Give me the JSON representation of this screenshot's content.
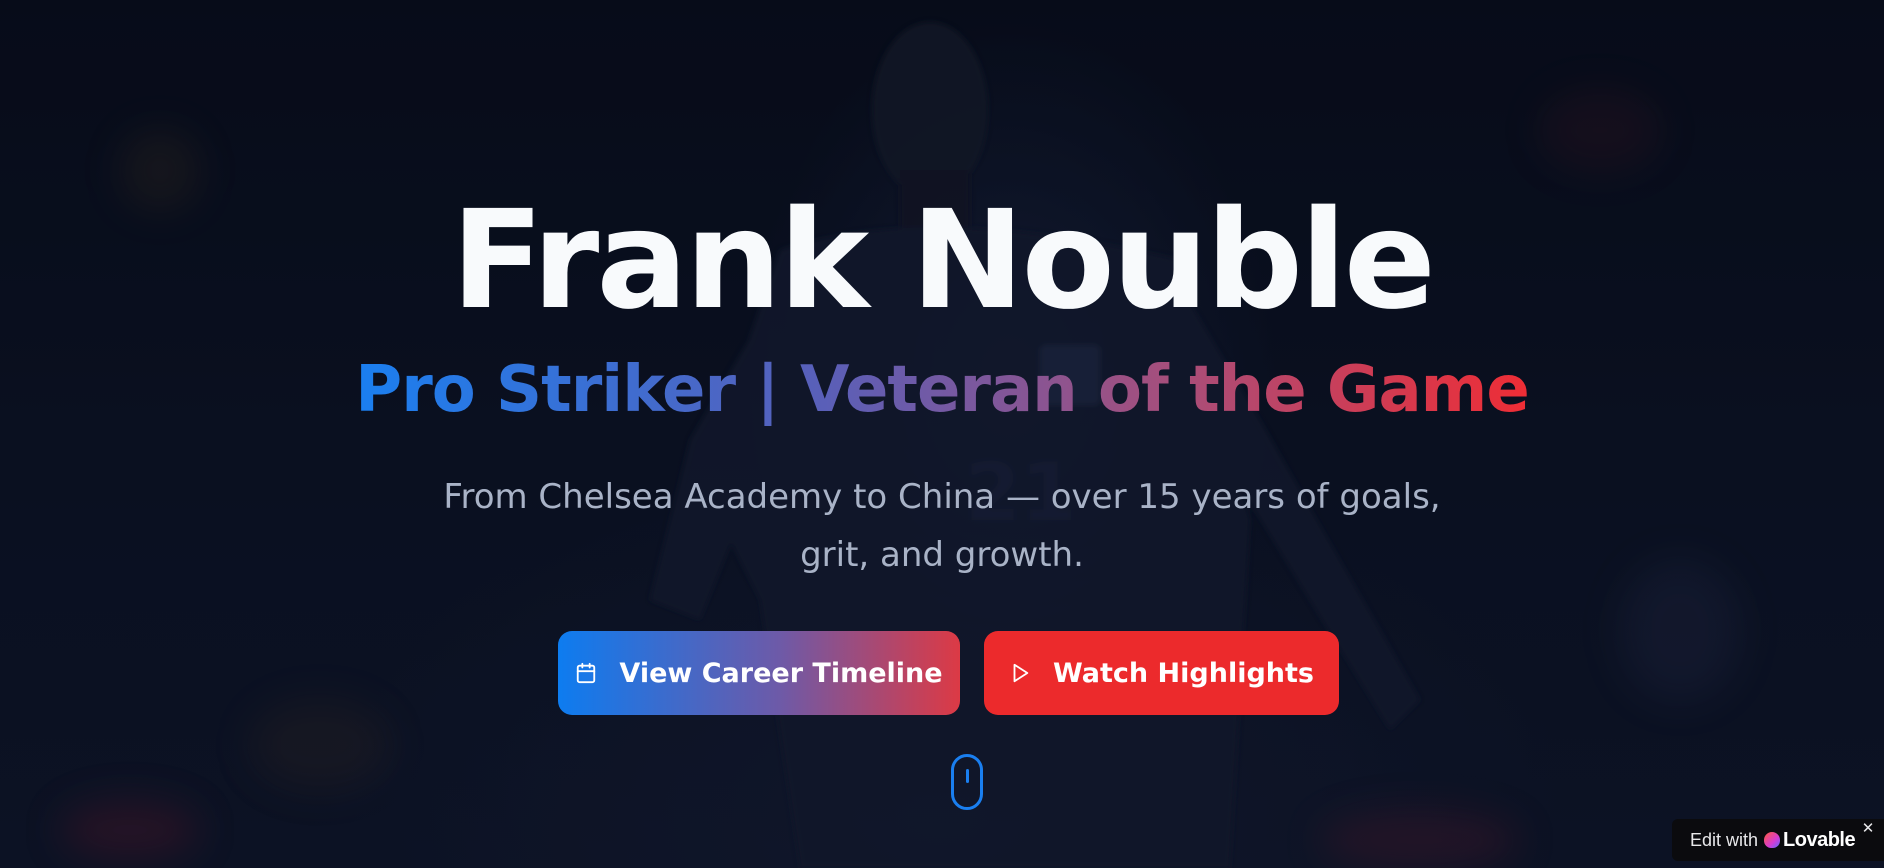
{
  "hero": {
    "name": "Frank Nouble",
    "subtitle": "Pro Striker | Veteran of the Game",
    "description": "From Chelsea Academy to China — over 15 years of goals, grit, and growth."
  },
  "actions": {
    "timeline_label": "View Career Timeline",
    "timeline_icon": "calendar-icon",
    "highlights_label": "Watch Highlights",
    "highlights_icon": "play-icon"
  },
  "scroll_indicator": {
    "icon": "mouse-scroll-icon"
  },
  "lovable_badge": {
    "prefix": "Edit with",
    "brand": "Lovable",
    "close": "✕"
  },
  "colors": {
    "background": "#0a0f1e",
    "title": "#f8fafc",
    "description": "#a9b3c7",
    "gradient_start": "#1a7ff0",
    "gradient_end": "#ef2d35",
    "highlights_button": "#ec2a2c",
    "accent_blue": "#1a7ff0"
  }
}
